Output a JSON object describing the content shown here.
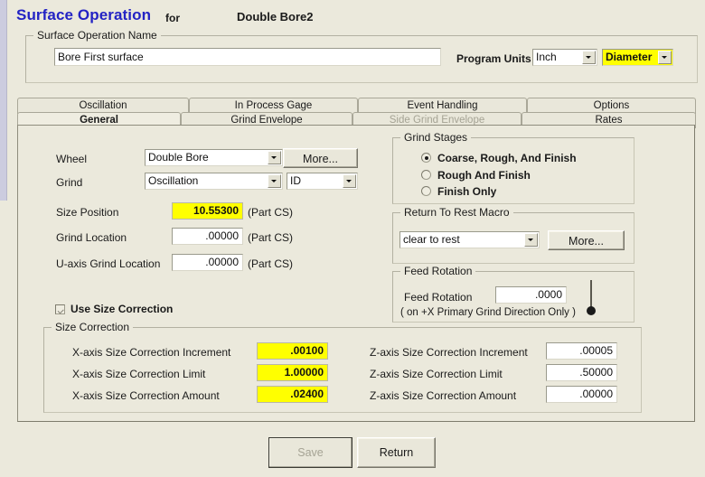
{
  "header": {
    "title": "Surface Operation",
    "for_label": "for",
    "part_name": "Double Bore2"
  },
  "name_group": {
    "legend": "Surface Operation Name",
    "value": "Bore First surface",
    "placeholder": ""
  },
  "program_units": {
    "label": "Program Units",
    "units_value": "Inch",
    "mode_value": "Diameter"
  },
  "tabs": {
    "top_row": [
      {
        "label": "Oscillation",
        "active": false,
        "disabled": false
      },
      {
        "label": "In Process Gage",
        "active": false,
        "disabled": false
      },
      {
        "label": "Event Handling",
        "active": false,
        "disabled": false
      },
      {
        "label": "Options",
        "active": false,
        "disabled": false
      }
    ],
    "bottom_row": [
      {
        "label": "General",
        "active": true,
        "disabled": false
      },
      {
        "label": "Grind Envelope",
        "active": false,
        "disabled": false
      },
      {
        "label": "Side Grind Envelope",
        "active": false,
        "disabled": true
      },
      {
        "label": "Rates",
        "active": false,
        "disabled": false
      }
    ]
  },
  "general": {
    "wheel_label": "Wheel",
    "wheel_value": "Double Bore",
    "wheel_more_label": "More...",
    "grind_label": "Grind",
    "grind_value": "Oscillation",
    "grind_type_value": "ID",
    "size_position_label": "Size Position",
    "size_position_value": "10.55300",
    "size_position_units": "(Part CS)",
    "grind_location_label": "Grind Location",
    "grind_location_value": ".00000",
    "grind_location_units": "(Part CS)",
    "u_axis_label": "U-axis Grind Location",
    "u_axis_value": ".00000",
    "u_axis_units": "(Part CS)"
  },
  "grind_stages": {
    "legend": "Grind Stages",
    "options": [
      {
        "label": "Coarse, Rough, And Finish",
        "selected": true
      },
      {
        "label": "Rough And Finish",
        "selected": false
      },
      {
        "label": "Finish Only",
        "selected": false
      }
    ]
  },
  "return_rest": {
    "legend": "Return To Rest Macro",
    "value": "clear to rest",
    "more_label": "More..."
  },
  "feed_rotation": {
    "legend": "Feed Rotation",
    "field_label": "Feed Rotation",
    "value": ".0000",
    "note": "( on +X Primary Grind Direction Only )"
  },
  "use_size_correction": {
    "label": "Use Size Correction",
    "checked": true
  },
  "size_correction": {
    "legend": "Size Correction",
    "rows": [
      {
        "x_label": "X-axis Size Correction Increment",
        "x_value": ".00100",
        "x_highlight": true,
        "z_label": "Z-axis Size Correction Increment",
        "z_value": ".00005",
        "z_highlight": false
      },
      {
        "x_label": "X-axis Size Correction Limit",
        "x_value": "1.00000",
        "x_highlight": true,
        "z_label": "Z-axis Size Correction Limit",
        "z_value": ".50000",
        "z_highlight": false
      },
      {
        "x_label": "X-axis Size Correction Amount",
        "x_value": ".02400",
        "x_highlight": true,
        "z_label": "Z-axis Size Correction Amount",
        "z_value": ".00000",
        "z_highlight": false
      }
    ]
  },
  "footer": {
    "save_label": "Save",
    "save_disabled": true,
    "return_label": "Return",
    "return_disabled": false
  },
  "colors": {
    "background": "#ebe9dc",
    "title": "#2323c4",
    "highlight": "#ffff00",
    "field_bg": "#ffffff",
    "disabled_text": "#a5a394"
  }
}
